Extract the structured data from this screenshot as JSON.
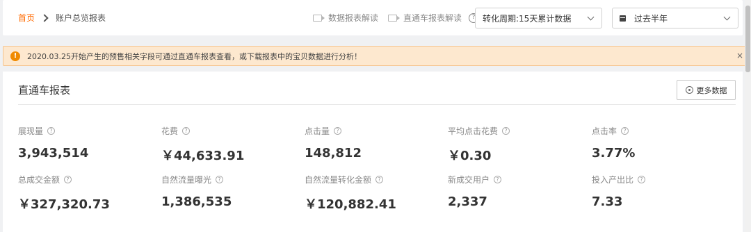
{
  "breadcrumb": {
    "home": "首页",
    "current": "账户总览报表"
  },
  "header_links": [
    {
      "label": "数据报表解读",
      "icon": "video-icon"
    },
    {
      "label": "直通车报表解读",
      "icon": "video-icon"
    }
  ],
  "help_mark": "?",
  "period_select": {
    "value": "转化周期:15天累计数据"
  },
  "range_select": {
    "value": "过去半年",
    "icon": "calendar-icon"
  },
  "notice": {
    "icon_glyph": "!",
    "text": "2020.03.25开始产生的预售相关字段可通过直通车报表查看，或下载报表中的宝贝数据进行分析！",
    "close": "×"
  },
  "panel": {
    "title": "直通车报表",
    "more_button": "更多数据"
  },
  "metrics": [
    {
      "label": "展现量",
      "value": "3,943,514"
    },
    {
      "label": "花费",
      "value": "￥44,633.91"
    },
    {
      "label": "点击量",
      "value": "148,812"
    },
    {
      "label": "平均点击花费",
      "value": "￥0.30"
    },
    {
      "label": "点击率",
      "value": "3.77%"
    },
    {
      "label": "总成交金额",
      "value": "￥327,320.73"
    },
    {
      "label": "自然流量曝光",
      "value": "1,386,535"
    },
    {
      "label": "自然流量转化金额",
      "value": "￥120,882.41"
    },
    {
      "label": "新成交用户",
      "value": "2,337"
    },
    {
      "label": "投入产出比",
      "value": "7.33"
    }
  ],
  "colors": {
    "accent": "#ff6a00",
    "notice_bg": "#fde8cf",
    "warn": "#f08a00"
  }
}
